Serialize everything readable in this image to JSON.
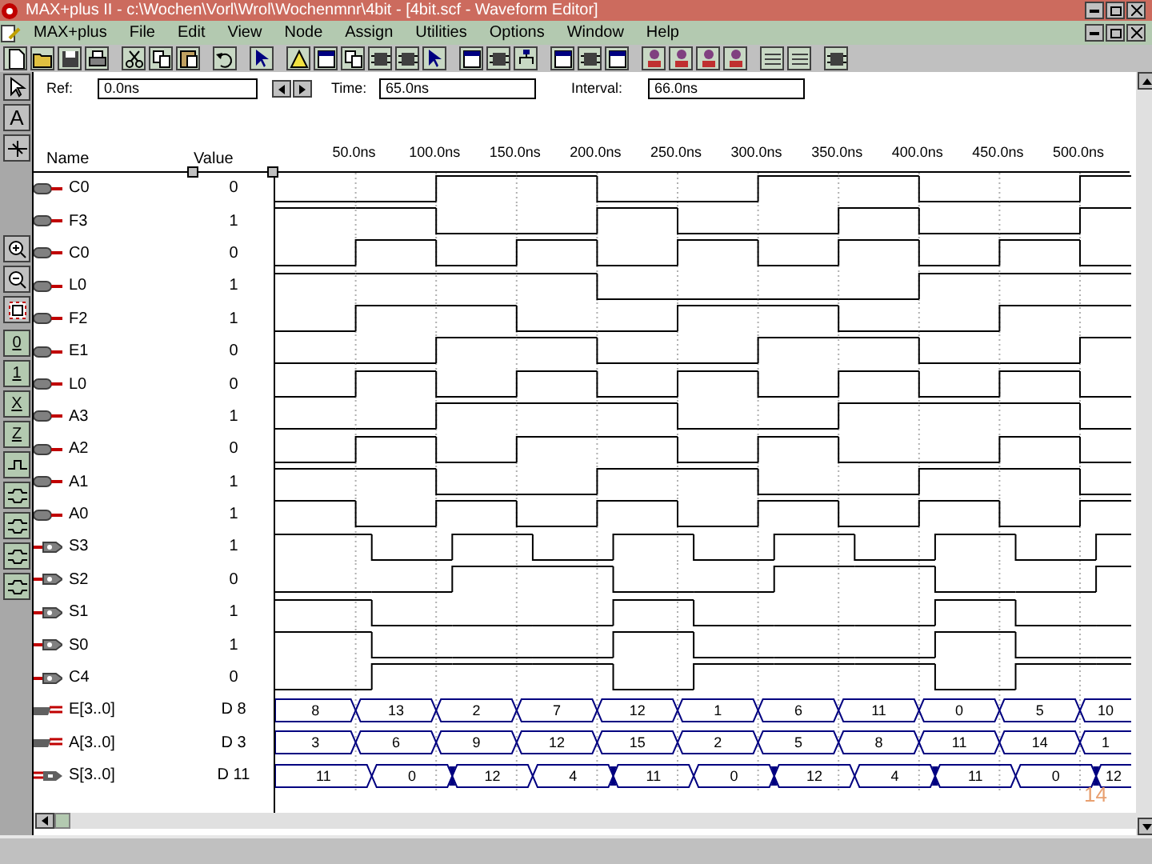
{
  "window": {
    "title": "MAX+plus II - c:\\Wochen\\Vorl\\Wrol\\Wochenmnr\\4bit - [4bit.scf - Waveform Editor]"
  },
  "menu": [
    "MAX+plus",
    "File",
    "Edit",
    "View",
    "Node",
    "Assign",
    "Utilities",
    "Options",
    "Window",
    "Help"
  ],
  "fields": [
    {
      "label": "Ref:",
      "value": "0.0ns"
    },
    {
      "label": "Time:",
      "value": "65.0ns"
    },
    {
      "label": "Interval:",
      "value": "66.0ns"
    }
  ],
  "palette": [
    {
      "kind": "pointer"
    },
    {
      "kind": "text",
      "label": "A"
    },
    {
      "kind": "node"
    },
    {
      "kind": "zoom_in"
    },
    {
      "kind": "zoom_out"
    },
    {
      "kind": "fit"
    },
    {
      "kind": "level",
      "label": "0"
    },
    {
      "kind": "level",
      "label": "1"
    },
    {
      "kind": "level",
      "label": "X"
    },
    {
      "kind": "level",
      "label": "Z"
    },
    {
      "kind": "invert"
    },
    {
      "kind": "count"
    },
    {
      "kind": "count"
    },
    {
      "kind": "count"
    },
    {
      "kind": "count"
    }
  ],
  "columns": {
    "name": "Name",
    "value": "Value"
  },
  "time_ticks": [
    "50.0ns",
    "100.0ns",
    "150.0ns",
    "200.0ns",
    "250.0ns",
    "300.0ns",
    "350.0ns",
    "400.0ns",
    "450.0ns",
    "500.0ns"
  ],
  "signals": [
    {
      "name": "C0",
      "value": "0",
      "kind": "input",
      "delayed": false,
      "wave": [
        {
          "high": false
        },
        {
          "high": false
        },
        {
          "high": true
        },
        {
          "high": true
        },
        {
          "high": false
        },
        {
          "high": false
        },
        {
          "high": true
        },
        {
          "high": true
        },
        {
          "high": false
        },
        {
          "high": false
        },
        {
          "high": true
        }
      ]
    },
    {
      "name": "F3",
      "value": "1",
      "kind": "input",
      "delayed": false,
      "wave": [
        {
          "high": true
        },
        {
          "high": true
        },
        {
          "high": false
        },
        {
          "high": false
        },
        {
          "high": true
        },
        {
          "high": false
        },
        {
          "high": false
        },
        {
          "high": true
        },
        {
          "high": false
        },
        {
          "high": false
        },
        {
          "high": true
        }
      ]
    },
    {
      "name": "C0",
      "value": "0",
      "kind": "input",
      "delayed": false,
      "wave": [
        {
          "high": false
        },
        {
          "high": true
        },
        {
          "high": false
        },
        {
          "high": true
        },
        {
          "high": false
        },
        {
          "high": true
        },
        {
          "high": false
        },
        {
          "high": true
        },
        {
          "high": false
        },
        {
          "high": true
        },
        {
          "high": false
        }
      ]
    },
    {
      "name": "L0",
      "value": "1",
      "kind": "input",
      "delayed": false,
      "wave": [
        {
          "high": true
        },
        {
          "high": true
        },
        {
          "high": true
        },
        {
          "high": true
        },
        {
          "high": false
        },
        {
          "high": false
        },
        {
          "high": false
        },
        {
          "high": false
        },
        {
          "high": true
        },
        {
          "high": true
        },
        {
          "high": true
        }
      ]
    },
    {
      "name": "F2",
      "value": "1",
      "kind": "input",
      "delayed": false,
      "wave": [
        {
          "high": false
        },
        {
          "high": true
        },
        {
          "high": true
        },
        {
          "high": false
        },
        {
          "high": false
        },
        {
          "high": true
        },
        {
          "high": true
        },
        {
          "high": false
        },
        {
          "high": false
        },
        {
          "high": true
        },
        {
          "high": true
        }
      ]
    },
    {
      "name": "E1",
      "value": "0",
      "kind": "input",
      "delayed": false,
      "wave": [
        {
          "high": false
        },
        {
          "high": false
        },
        {
          "high": true
        },
        {
          "high": true
        },
        {
          "high": false
        },
        {
          "high": false
        },
        {
          "high": true
        },
        {
          "high": true
        },
        {
          "high": false
        },
        {
          "high": false
        },
        {
          "high": true
        }
      ]
    },
    {
      "name": "L0",
      "value": "0",
      "kind": "input",
      "delayed": false,
      "wave": [
        {
          "high": false
        },
        {
          "high": true
        },
        {
          "high": false
        },
        {
          "high": true
        },
        {
          "high": false
        },
        {
          "high": true
        },
        {
          "high": false
        },
        {
          "high": true
        },
        {
          "high": false
        },
        {
          "high": true
        },
        {
          "high": false
        }
      ]
    },
    {
      "name": "A3",
      "value": "1",
      "kind": "input",
      "delayed": false,
      "wave": [
        {
          "high": false
        },
        {
          "high": false
        },
        {
          "high": true
        },
        {
          "high": true
        },
        {
          "high": true
        },
        {
          "high": false
        },
        {
          "high": false
        },
        {
          "high": true
        },
        {
          "high": true
        },
        {
          "high": true
        },
        {
          "high": false
        }
      ]
    },
    {
      "name": "A2",
      "value": "0",
      "kind": "input",
      "delayed": false,
      "wave": [
        {
          "high": false
        },
        {
          "high": true
        },
        {
          "high": false
        },
        {
          "high": true
        },
        {
          "high": true
        },
        {
          "high": false
        },
        {
          "high": true
        },
        {
          "high": false
        },
        {
          "high": false
        },
        {
          "high": true
        },
        {
          "high": false
        }
      ]
    },
    {
      "name": "A1",
      "value": "1",
      "kind": "input",
      "delayed": false,
      "wave": [
        {
          "high": true
        },
        {
          "high": true
        },
        {
          "high": false
        },
        {
          "high": false
        },
        {
          "high": true
        },
        {
          "high": true
        },
        {
          "high": false
        },
        {
          "high": false
        },
        {
          "high": true
        },
        {
          "high": true
        },
        {
          "high": false
        }
      ]
    },
    {
      "name": "A0",
      "value": "1",
      "kind": "input",
      "delayed": false,
      "wave": [
        {
          "high": true
        },
        {
          "high": false
        },
        {
          "high": true
        },
        {
          "high": false
        },
        {
          "high": true
        },
        {
          "high": false
        },
        {
          "high": true
        },
        {
          "high": false
        },
        {
          "high": true
        },
        {
          "high": false
        },
        {
          "high": true
        }
      ]
    },
    {
      "name": "S3",
      "value": "1",
      "kind": "output",
      "delayed": true,
      "wave": [
        {
          "high": true
        },
        {
          "high": false
        },
        {
          "high": true
        },
        {
          "high": false
        },
        {
          "high": true
        },
        {
          "high": false
        },
        {
          "high": true
        },
        {
          "high": false
        },
        {
          "high": true
        },
        {
          "high": false
        },
        {
          "high": true
        }
      ]
    },
    {
      "name": "S2",
      "value": "0",
      "kind": "output",
      "delayed": true,
      "wave": [
        {
          "high": false
        },
        {
          "high": false
        },
        {
          "high": true
        },
        {
          "high": true
        },
        {
          "high": false
        },
        {
          "high": false
        },
        {
          "high": true
        },
        {
          "high": true
        },
        {
          "high": false
        },
        {
          "high": false
        },
        {
          "high": true
        }
      ]
    },
    {
      "name": "S1",
      "value": "1",
      "kind": "output",
      "delayed": true,
      "wave": [
        {
          "high": true
        },
        {
          "high": false
        },
        {
          "high": false
        },
        {
          "high": false
        },
        {
          "high": true
        },
        {
          "high": false
        },
        {
          "high": false
        },
        {
          "high": false
        },
        {
          "high": true
        },
        {
          "high": false
        },
        {
          "high": false
        }
      ]
    },
    {
      "name": "S0",
      "value": "1",
      "kind": "output",
      "delayed": true,
      "wave": [
        {
          "high": true
        },
        {
          "high": false
        },
        {
          "high": false
        },
        {
          "high": false
        },
        {
          "high": true
        },
        {
          "high": false
        },
        {
          "high": false
        },
        {
          "high": false
        },
        {
          "high": true
        },
        {
          "high": false
        },
        {
          "high": false
        }
      ]
    },
    {
      "name": "C4",
      "value": "0",
      "kind": "output",
      "delayed": true,
      "wave": [
        {
          "high": false
        },
        {
          "high": true
        },
        {
          "high": true
        },
        {
          "high": true
        },
        {
          "high": false
        },
        {
          "high": true
        },
        {
          "high": true
        },
        {
          "high": true
        },
        {
          "high": false
        },
        {
          "high": true
        },
        {
          "high": true
        }
      ]
    },
    {
      "name": "E[3..0]",
      "value": "D 8",
      "kind": "input_bus",
      "delayed": false,
      "segments": [
        "8",
        "13",
        "2",
        "7",
        "12",
        "1",
        "6",
        "11",
        "0",
        "5",
        "10"
      ]
    },
    {
      "name": "A[3..0]",
      "value": "D 3",
      "kind": "input_bus",
      "delayed": false,
      "segments": [
        "3",
        "6",
        "9",
        "12",
        "15",
        "2",
        "5",
        "8",
        "11",
        "14",
        "1"
      ]
    },
    {
      "name": "S[3..0]",
      "value": "D 11",
      "kind": "output_bus",
      "delayed": true,
      "segments": [
        "11",
        "0",
        "12",
        "4",
        "11",
        "0",
        "12",
        "4",
        "11",
        "0",
        "12"
      ]
    }
  ],
  "page_number": "14"
}
